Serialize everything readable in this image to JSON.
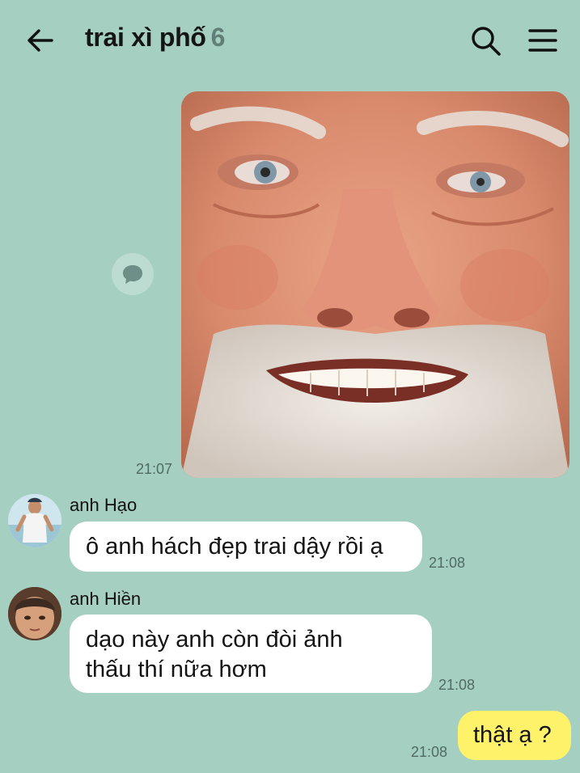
{
  "header": {
    "title": "trai xì phố",
    "member_count": "6",
    "back_icon": "arrow-left-icon",
    "search_icon": "search-icon",
    "menu_icon": "hamburger-menu-icon"
  },
  "messages": [
    {
      "type": "image",
      "icon": "image",
      "time": "21:07",
      "reply_icon": "speech-bubble-icon"
    },
    {
      "sender": "anh Hạo",
      "text": "ô anh hách đẹp trai dậy rồi ạ",
      "time": "21:08"
    },
    {
      "sender": "anh Hiền",
      "line1": "dạo này anh còn đòi ảnh",
      "line2": "thấu thí nữa hơm",
      "time": "21:08"
    },
    {
      "sender": "me",
      "text": "thật ạ ?",
      "time": "21:08"
    }
  ],
  "colors": {
    "background": "#a5cfc1",
    "incoming_bubble": "#ffffff",
    "outgoing_bubble": "#fff26b"
  }
}
